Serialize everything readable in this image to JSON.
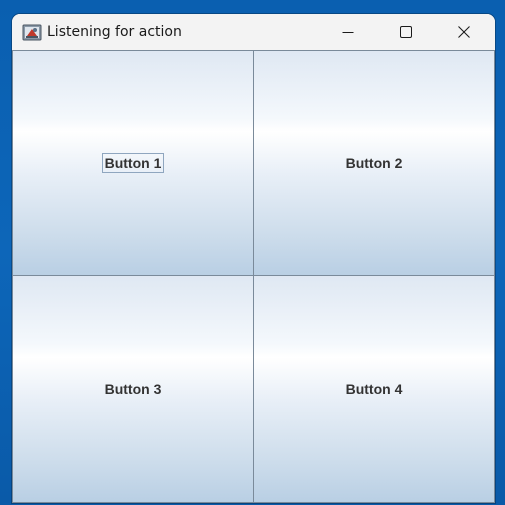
{
  "window": {
    "title": "Listening for action",
    "icon": "java-app-icon",
    "controls": {
      "minimize": "minimize-icon",
      "maximize": "maximize-icon",
      "close": "close-icon"
    }
  },
  "buttons": [
    {
      "label": "Button 1",
      "focused": true
    },
    {
      "label": "Button 2",
      "focused": false
    },
    {
      "label": "Button 3",
      "focused": false
    },
    {
      "label": "Button 4",
      "focused": false
    }
  ],
  "colors": {
    "desktop": "#0d66b9",
    "titlebar": "#f3f3f3",
    "button_gradient_top": "#dfe8f3",
    "button_gradient_bottom": "#b9cfe4",
    "button_text": "#333333"
  }
}
